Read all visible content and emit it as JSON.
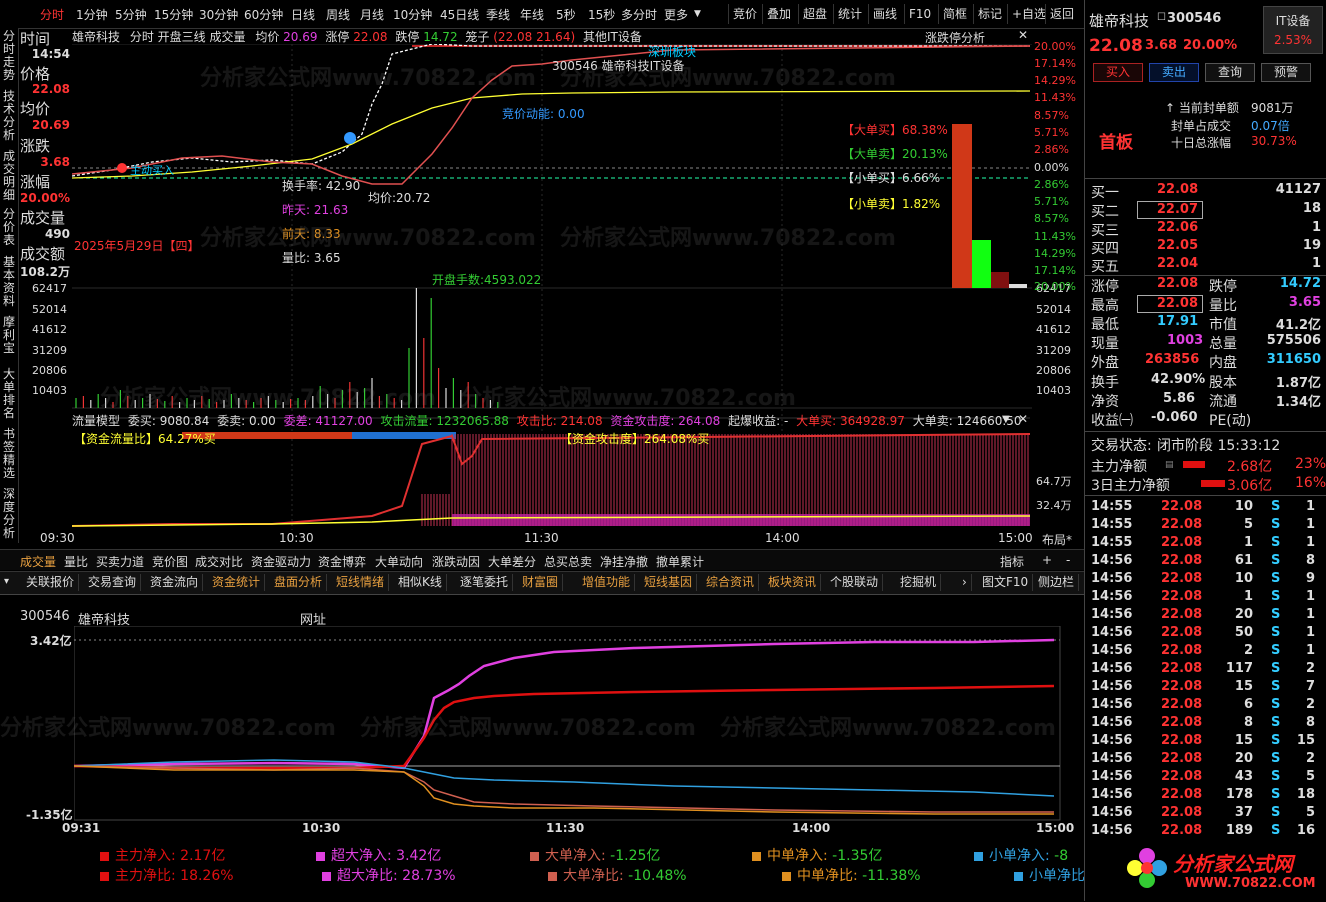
{
  "topbar": {
    "periods": [
      "分时",
      "1分钟",
      "5分钟",
      "15分钟",
      "30分钟",
      "60分钟",
      "日线",
      "周线",
      "月线",
      "10分钟",
      "45日线",
      "季线",
      "年线",
      "5秒",
      "15秒",
      "多分时",
      "更多"
    ],
    "active": "分时",
    "tools": [
      "竞价",
      "叠加",
      "超盘",
      "统计",
      "画线",
      "F10",
      "简框",
      "标记",
      "+自选",
      "返回"
    ]
  },
  "vtabs": [
    "分时走势",
    "技术分析",
    "成交明细",
    "分价表",
    "基本资料",
    "摩利宝",
    "大单排名",
    "书签精选",
    "深度分析"
  ],
  "chart_header": {
    "name": "雄帝科技",
    "mode": "分时 开盘三线 成交量",
    "avg_label": "均价",
    "avg_val": "20.69",
    "limitup_label": "涨停",
    "limitup_val": "22.08",
    "limitdn_label": "跌停",
    "limitdn_val": "14.72",
    "cage_label": "笼子",
    "cage_val": "(22.08 21.64)",
    "concept": "其他IT设备",
    "analysis": "涨跌停分析"
  },
  "info": {
    "time_label": "时间",
    "time_val": "14:54",
    "price_label": "价格",
    "price_val": "22.08",
    "avg_label": "均价",
    "avg_val": "20.69",
    "chg_label": "涨跌",
    "chg_val": "3.68",
    "pct_label": "涨幅",
    "pct_val": "20.00%",
    "vol_label": "成交量",
    "vol_val": "490",
    "amt_label": "成交额",
    "amt_val": "108.2万"
  },
  "price_axis_right": [
    "20.00%",
    "17.14%",
    "14.29%",
    "11.43%",
    "8.57%",
    "5.71%",
    "2.86%",
    "0.00%",
    "2.86%",
    "5.71%",
    "8.57%",
    "11.43%",
    "14.29%",
    "17.14%",
    "20.00%"
  ],
  "annotations": {
    "sector": "深圳板块",
    "code_name": "300546  雄帝科技IT设备",
    "auction": "竞价动能: 0.00",
    "turnover": "换手率: 42.90",
    "avgprice": "均价:20.72",
    "yesterday": "昨天: 21.63",
    "daybefore": "前天: 8.33",
    "volratio": "量比: 3.65",
    "date": "2025年5月29日【四】",
    "openvol": "开盘手数:4593.022",
    "bigbuy": "【大单买】68.38%",
    "bigsell": "【大单卖】20.13%",
    "smallbuy": "【小单买】6.66%",
    "smallsell": "【小单卖】1.82%",
    "zhudong": "主动买入"
  },
  "vol_axis": [
    "62417",
    "52014",
    "41612",
    "31209",
    "20806",
    "10403"
  ],
  "flow_header": {
    "model": "流量模型",
    "weimai": "委买: 9080.84",
    "weimai2": "委卖: 0.00",
    "weicha": "委差: 41127.00",
    "gongji": "攻击流量: 1232065.88",
    "gongjibi": "攻击比: 214.08",
    "zijin": "资金攻击度: 264.08",
    "qibao": "起爆收益: -",
    "dadanmai": "大单买: 364928.97",
    "dadanmai2": "大单卖: 124660.50",
    "liuliangbi": "【资金流量比】64.27%买",
    "gongjidu": "【资金攻击度】264.08%买",
    "axis1": "64.7万",
    "axis2": "32.4万"
  },
  "time_axis": [
    "09:30",
    "10:30",
    "11:30",
    "14:00",
    "15:00"
  ],
  "layout_label": "布局*",
  "row1_tabs": [
    "成交量",
    "量比",
    "买卖力道",
    "竞价图",
    "成交对比",
    "资金驱动力",
    "资金博弈",
    "大单动向",
    "涨跌动因",
    "大单差分",
    "总买总卖",
    "净挂净撤",
    "撤单累计"
  ],
  "row1_right": [
    "指标",
    "+",
    "-"
  ],
  "row2_tabs": [
    "关联报价",
    "交易查询",
    "资金流向",
    "资金统计",
    "盘面分析",
    "短线情绪",
    "相似K线",
    "逐笔委托",
    "财富圈",
    "增值功能",
    "短线基因",
    "综合资讯",
    "板块资讯",
    "个股联动",
    "挖掘机"
  ],
  "row2_right": [
    "图文F10",
    "侧边栏"
  ],
  "lower": {
    "code": "300546",
    "name": "雄帝科技",
    "url": "网址",
    "ymax": "3.42亿",
    "ymin": "-1.35亿",
    "times": [
      "09:31",
      "10:30",
      "11:30",
      "14:00",
      "15:00"
    ],
    "legend": [
      {
        "label": "主力净入:",
        "value": "2.17亿",
        "color": "#e01010"
      },
      {
        "label": "超大净入:",
        "value": "3.42亿",
        "color": "#e040e0"
      },
      {
        "label": "大单净入:",
        "value": "-1.25亿",
        "color": "#d06050"
      },
      {
        "label": "中单净入:",
        "value": "-1.35亿",
        "color": "#e09020"
      },
      {
        "label": "小单净入:",
        "value": "-8",
        "color": "#30a0e0"
      },
      {
        "label": "主力净比:",
        "value": "18.26%",
        "color": "#e01010"
      },
      {
        "label": "超大净比:",
        "value": "28.73%",
        "color": "#e040e0"
      },
      {
        "label": "大单净比:",
        "value": "-10.48%",
        "color": "#d06050"
      },
      {
        "label": "中单净比:",
        "value": "-11.38%",
        "color": "#e09020"
      },
      {
        "label": "小单净比",
        "value": "",
        "color": "#30a0e0"
      }
    ]
  },
  "right_panel": {
    "name": "雄帝科技",
    "code": "300546",
    "sector": "IT设备",
    "sector_pct": "2.53%",
    "price": "22.08",
    "chg": "3.68",
    "pct": "20.00%",
    "buttons": [
      "买入",
      "卖出",
      "查询",
      "预警"
    ],
    "board": "首板",
    "seal_label": "当前封单额",
    "seal_val": "9081万",
    "seal_ratio_label": "封单占成交",
    "seal_ratio_val": "0.07倍",
    "ten_label": "十日总涨幅",
    "ten_val": "30.73%",
    "bids": [
      {
        "label": "买一",
        "price": "22.08",
        "vol": "41127"
      },
      {
        "label": "买二",
        "price": "22.07",
        "vol": "18"
      },
      {
        "label": "买三",
        "price": "22.06",
        "vol": "1"
      },
      {
        "label": "买四",
        "price": "22.05",
        "vol": "19"
      },
      {
        "label": "买五",
        "price": "22.04",
        "vol": "1"
      }
    ],
    "stats": [
      {
        "l1": "涨停",
        "v1": "22.08",
        "c1": "#f33",
        "l2": "跌停",
        "v2": "14.72",
        "c2": "#3c3"
      },
      {
        "l1": "最高",
        "v1": "22.08",
        "c1": "#f33",
        "l2": "量比",
        "v2": "3.65",
        "c2": "#e040e0"
      },
      {
        "l1": "最低",
        "v1": "17.91",
        "c1": "#3cf",
        "l2": "市值",
        "v2": "41.2亿",
        "c2": "#ddd"
      },
      {
        "l1": "现量",
        "v1": "1003",
        "c1": "#e040e0",
        "l2": "总量",
        "v2": "575506",
        "c2": "#ddd"
      },
      {
        "l1": "外盘",
        "v1": "263856",
        "c1": "#f33",
        "l2": "内盘",
        "v2": "311650",
        "c2": "#3cf"
      },
      {
        "l1": "换手",
        "v1": "42.90%",
        "c1": "#ddd",
        "l2": "股本",
        "v2": "1.87亿",
        "c2": "#ddd"
      },
      {
        "l1": "净资",
        "v1": "5.86",
        "c1": "#ddd",
        "l2": "流通",
        "v2": "1.34亿",
        "c2": "#ddd"
      },
      {
        "l1": "收益㈠",
        "v1": "-0.060",
        "c1": "#ddd",
        "l2": "PE(动)",
        "v2": "",
        "c2": "#ddd"
      }
    ],
    "trade_status_label": "交易状态:",
    "trade_status": "闭市阶段 15:33:12",
    "main_net_label": "主力净额",
    "main_net": "2.68亿",
    "main_net_pct": "23%",
    "three_label": "3日主力净额",
    "three_net": "3.06亿",
    "three_pct": "16%",
    "ticks": [
      {
        "t": "14:55",
        "p": "22.08",
        "v": "10",
        "s": "S",
        "n": "1"
      },
      {
        "t": "14:55",
        "p": "22.08",
        "v": "5",
        "s": "S",
        "n": "1"
      },
      {
        "t": "14:55",
        "p": "22.08",
        "v": "1",
        "s": "S",
        "n": "1"
      },
      {
        "t": "14:56",
        "p": "22.08",
        "v": "61",
        "s": "S",
        "n": "8"
      },
      {
        "t": "14:56",
        "p": "22.08",
        "v": "10",
        "s": "S",
        "n": "9"
      },
      {
        "t": "14:56",
        "p": "22.08",
        "v": "1",
        "s": "S",
        "n": "1"
      },
      {
        "t": "14:56",
        "p": "22.08",
        "v": "20",
        "s": "S",
        "n": "1"
      },
      {
        "t": "14:56",
        "p": "22.08",
        "v": "50",
        "s": "S",
        "n": "1"
      },
      {
        "t": "14:56",
        "p": "22.08",
        "v": "2",
        "s": "S",
        "n": "1"
      },
      {
        "t": "14:56",
        "p": "22.08",
        "v": "117",
        "s": "S",
        "n": "2"
      },
      {
        "t": "14:56",
        "p": "22.08",
        "v": "15",
        "s": "S",
        "n": "7"
      },
      {
        "t": "14:56",
        "p": "22.08",
        "v": "6",
        "s": "S",
        "n": "2"
      },
      {
        "t": "14:56",
        "p": "22.08",
        "v": "8",
        "s": "S",
        "n": "8"
      },
      {
        "t": "14:56",
        "p": "22.08",
        "v": "15",
        "s": "S",
        "n": "15"
      },
      {
        "t": "14:56",
        "p": "22.08",
        "v": "20",
        "s": "S",
        "n": "2"
      },
      {
        "t": "14:56",
        "p": "22.08",
        "v": "43",
        "s": "S",
        "n": "5"
      },
      {
        "t": "14:56",
        "p": "22.08",
        "v": "178",
        "s": "S",
        "n": "18"
      },
      {
        "t": "14:56",
        "p": "22.08",
        "v": "37",
        "s": "S",
        "n": "5"
      },
      {
        "t": "14:56",
        "p": "22.08",
        "v": "189",
        "s": "S",
        "n": "16"
      }
    ],
    "logo_text": "分析家公式网",
    "logo_url": "WWW.70822.COM"
  },
  "watermark": "分析家公式网www.70822.com"
}
